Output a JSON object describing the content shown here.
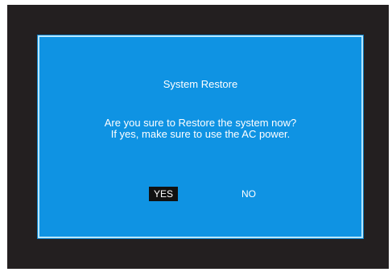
{
  "dialog": {
    "title": "System Restore",
    "message_line1": "Are you sure to Restore the system now?",
    "message_line2": "If yes, make sure to use the AC power.",
    "yes_label": "YES",
    "no_label": "NO",
    "selected_option": "YES"
  },
  "colors": {
    "screen_background": "#231f20",
    "dialog_background": "#0f93e3",
    "dialog_border": "#b7e7ff",
    "selected_button_background": "#111111",
    "text": "#ffffff"
  }
}
